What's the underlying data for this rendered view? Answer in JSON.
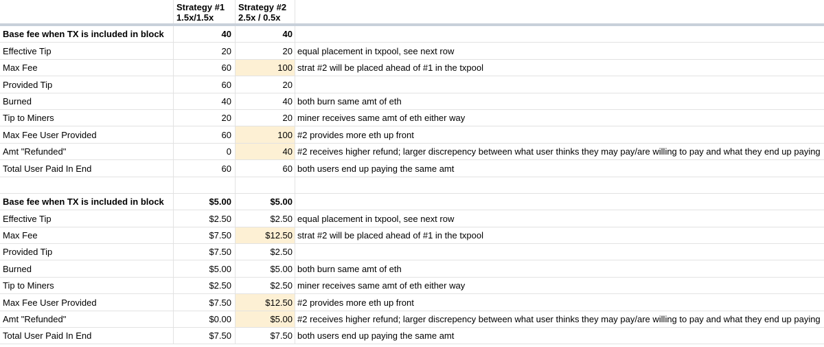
{
  "header": {
    "col1_line1": "Strategy #1",
    "col1_line2": "1.5x/1.5x",
    "col2_line1": "Strategy #2",
    "col2_line2": "2.5x / 0.5x"
  },
  "table1": [
    {
      "label": "Base fee when TX is included in block",
      "s1": "40",
      "s2": "40",
      "note": "",
      "bold": true,
      "hl": false
    },
    {
      "label": "Effective Tip",
      "s1": "20",
      "s2": "20",
      "note": "equal placement in txpool, see next row",
      "bold": false,
      "hl": false
    },
    {
      "label": "Max Fee",
      "s1": "60",
      "s2": "100",
      "note": "strat #2 will be placed ahead of #1 in the txpool",
      "bold": false,
      "hl": true
    },
    {
      "label": "Provided Tip",
      "s1": "60",
      "s2": "20",
      "note": "",
      "bold": false,
      "hl": false
    },
    {
      "label": "Burned",
      "s1": "40",
      "s2": "40",
      "note": "both burn same amt of eth",
      "bold": false,
      "hl": false
    },
    {
      "label": "Tip to Miners",
      "s1": "20",
      "s2": "20",
      "note": "miner receives same amt of eth either way",
      "bold": false,
      "hl": false
    },
    {
      "label": "Max Fee User Provided",
      "s1": "60",
      "s2": "100",
      "note": "#2 provides more eth up front",
      "bold": false,
      "hl": true
    },
    {
      "label": "Amt \"Refunded\"",
      "s1": "0",
      "s2": "40",
      "note": "#2 receives higher refund; larger discrepency between what user thinks they may pay/are willing to pay and what they end up paying",
      "bold": false,
      "hl": true
    },
    {
      "label": "Total User Paid In End",
      "s1": "60",
      "s2": "60",
      "note": "both users end up paying the same amt",
      "bold": false,
      "hl": false
    }
  ],
  "table2": [
    {
      "label": "Base fee when TX is included in block",
      "s1": "$5.00",
      "s2": "$5.00",
      "note": "",
      "bold": true,
      "hl": false
    },
    {
      "label": "Effective Tip",
      "s1": "$2.50",
      "s2": "$2.50",
      "note": "equal placement in txpool, see next row",
      "bold": false,
      "hl": false
    },
    {
      "label": "Max Fee",
      "s1": "$7.50",
      "s2": "$12.50",
      "note": "strat #2 will be placed ahead of #1 in the txpool",
      "bold": false,
      "hl": true
    },
    {
      "label": "Provided Tip",
      "s1": "$7.50",
      "s2": "$2.50",
      "note": "",
      "bold": false,
      "hl": false
    },
    {
      "label": "Burned",
      "s1": "$5.00",
      "s2": "$5.00",
      "note": "both burn same amt of eth",
      "bold": false,
      "hl": false
    },
    {
      "label": "Tip to Miners",
      "s1": "$2.50",
      "s2": "$2.50",
      "note": "miner receives same amt of eth either way",
      "bold": false,
      "hl": false
    },
    {
      "label": "Max Fee User Provided",
      "s1": "$7.50",
      "s2": "$12.50",
      "note": "#2 provides more eth up front",
      "bold": false,
      "hl": true
    },
    {
      "label": "Amt \"Refunded\"",
      "s1": "$0.00",
      "s2": "$5.00",
      "note": "#2 receives higher refund; larger discrepency between what user thinks they may pay/are willing to pay and what they end up paying",
      "bold": false,
      "hl": true
    },
    {
      "label": "Total User Paid In End",
      "s1": "$7.50",
      "s2": "$7.50",
      "note": "both users end up paying the same amt",
      "bold": false,
      "hl": false
    }
  ]
}
